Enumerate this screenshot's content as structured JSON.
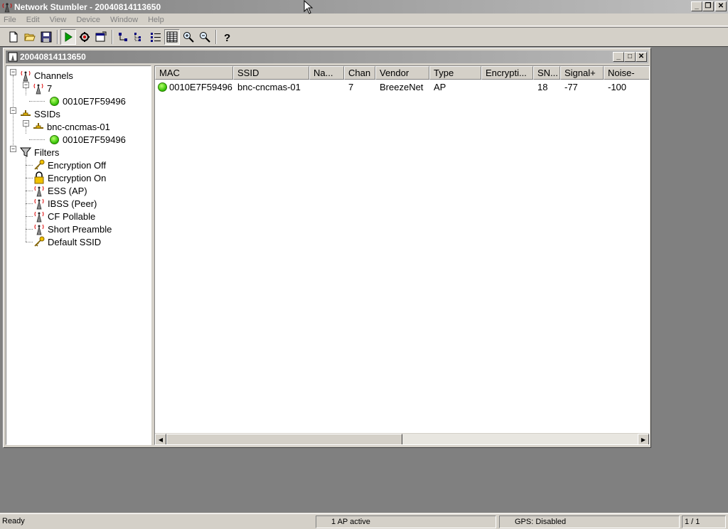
{
  "app": {
    "title": "Network Stumbler - 20040814113650"
  },
  "menu": [
    "File",
    "Edit",
    "View",
    "Device",
    "Window",
    "Help"
  ],
  "toolbar": {
    "buttons": [
      "new-document-icon",
      "open-folder-icon",
      "save-icon",
      "play-icon",
      "scan-options-icon",
      "properties-icon",
      "sort-ascending-icon",
      "tree-view-icon",
      "list-view-icon",
      "grid-view-icon",
      "zoom-in-icon",
      "zoom-out-icon",
      "help-icon"
    ]
  },
  "document": {
    "title": "20040814113650"
  },
  "tree": {
    "channels": "Channels",
    "channel_7": "7",
    "channel_7_ap": "0010E7F59496",
    "ssids": "SSIDs",
    "ssid_bnc": "bnc-cncmas-01",
    "ssid_bnc_ap": "0010E7F59496",
    "filters": "Filters",
    "filter_items": [
      "Encryption Off",
      "Encryption On",
      "ESS (AP)",
      "IBSS (Peer)",
      "CF Pollable",
      "Short Preamble",
      "Default SSID"
    ]
  },
  "list": {
    "columns": [
      "MAC",
      "SSID",
      "Na...",
      "Chan",
      "Vendor",
      "Type",
      "Encrypti...",
      "SN...",
      "Signal+",
      "Noise-"
    ],
    "rows": [
      {
        "mac": "0010E7F59496",
        "ssid": "bnc-cncmas-01",
        "name": "",
        "chan": "7",
        "vendor": "BreezeNet",
        "type": "AP",
        "encryption": "",
        "snr": "18",
        "signal": "-77",
        "noise": "-100"
      }
    ]
  },
  "status": {
    "ready": "Ready",
    "ap_active": "1 AP active",
    "gps": "GPS: Disabled",
    "page": "1 / 1"
  },
  "colors": {
    "title_bar": "#808080",
    "active_dot": "#2fbf00",
    "workspace": "#808080"
  }
}
